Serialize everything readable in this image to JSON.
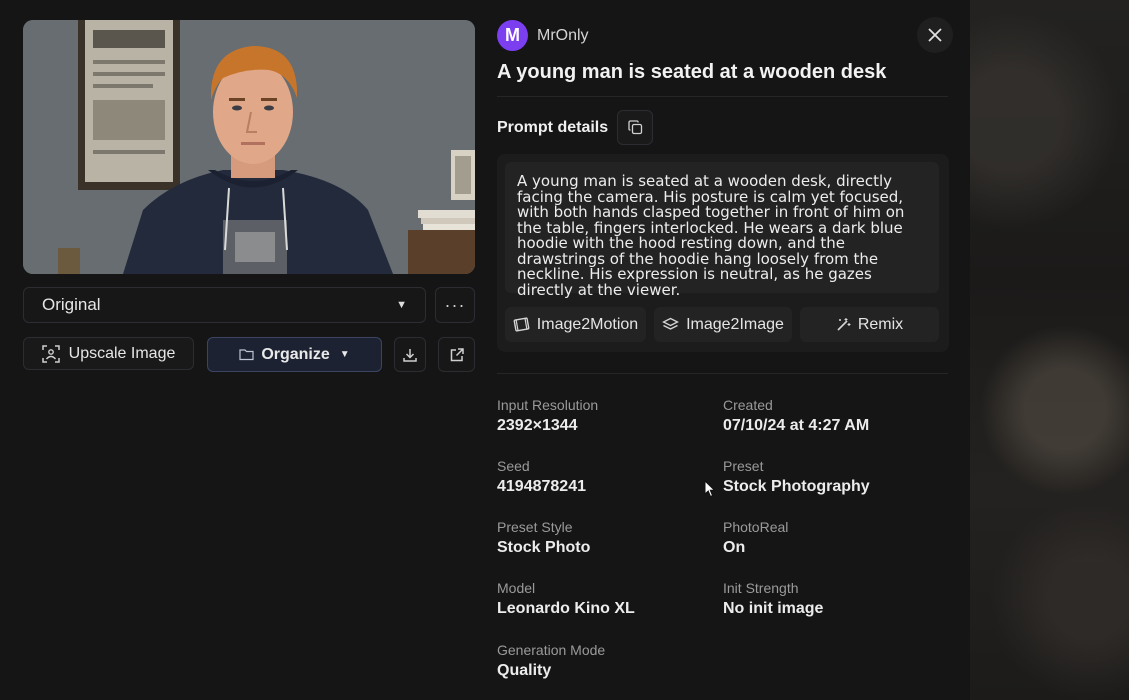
{
  "image_preview": {
    "alt": "A young man is seated at a wooden desk"
  },
  "variant_select": {
    "value": "Original"
  },
  "left_actions": {
    "upscale_label": "Upscale Image",
    "organize_label": "Organize"
  },
  "author": {
    "initial": "M",
    "name": "MrOnly",
    "avatar_color": "#7b3ff0"
  },
  "title": "A young man is seated at a wooden desk",
  "prompt": {
    "label": "Prompt details",
    "text": "A young man is seated at a wooden desk, directly facing the camera. His posture is calm yet focused, with both hands clasped together in front of him on the table, fingers interlocked. He wears a dark blue hoodie with the hood resting down, and the drawstrings of the hoodie hang loosely from the neckline. His expression is neutral, as he gazes directly at the viewer."
  },
  "actions": {
    "image2motion": "Image2Motion",
    "image2image": "Image2Image",
    "remix": "Remix"
  },
  "details": {
    "input_resolution": {
      "label": "Input Resolution",
      "value": "2392×1344"
    },
    "created": {
      "label": "Created",
      "value": "07/10/24 at 4:27 AM"
    },
    "seed": {
      "label": "Seed",
      "value": "4194878241"
    },
    "preset": {
      "label": "Preset",
      "value": "Stock Photography"
    },
    "preset_style": {
      "label": "Preset Style",
      "value": "Stock Photo"
    },
    "photoreal": {
      "label": "PhotoReal",
      "value": "On"
    },
    "model": {
      "label": "Model",
      "value": "Leonardo Kino XL"
    },
    "init_strength": {
      "label": "Init Strength",
      "value": "No init image"
    },
    "generation_mode": {
      "label": "Generation Mode",
      "value": "Quality"
    }
  },
  "colors": {
    "accent": "#7b3ff0",
    "organize_bg": "#1d2232",
    "panel_bg": "#151515"
  }
}
